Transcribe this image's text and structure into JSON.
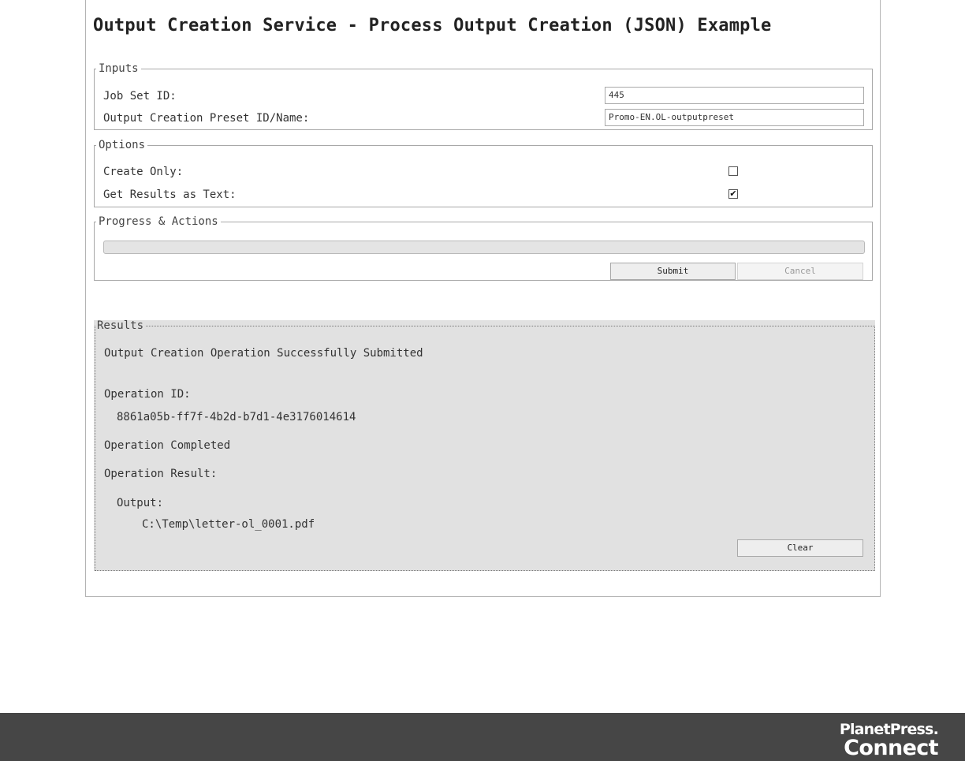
{
  "page": {
    "title": "Output Creation Service - Process Output Creation (JSON) Example"
  },
  "inputs": {
    "legend": "Inputs",
    "job_set_id_label": "Job Set ID:",
    "job_set_id_value": "445",
    "preset_label": "Output Creation Preset ID/Name:",
    "preset_value": "Promo-EN.OL-outputpreset"
  },
  "options": {
    "legend": "Options",
    "create_only_label": "Create Only:",
    "create_only_checked": false,
    "results_as_text_label": "Get Results as Text:",
    "results_as_text_checked": true
  },
  "progress": {
    "legend": "Progress & Actions",
    "percent": 0,
    "submit_label": "Submit",
    "cancel_label": "Cancel",
    "cancel_disabled": true
  },
  "results": {
    "legend": "Results",
    "submitted_message": "Output Creation Operation Successfully Submitted",
    "operation_id_label": "Operation ID:",
    "operation_id_value": "8861a05b-ff7f-4b2d-b7d1-4e3176014614",
    "completed_message": "Operation Completed",
    "result_label": "Operation Result:",
    "output_label": "Output:",
    "output_path": "C:\\Temp\\letter-ol_0001.pdf",
    "clear_label": "Clear"
  },
  "footer": {
    "brand_line1": "PlanetPress.",
    "brand_line2": "Connect"
  },
  "colors": {
    "footer_bg": "#464646",
    "results_bg": "#e1e1e1",
    "brand_text": "#ffffff"
  }
}
